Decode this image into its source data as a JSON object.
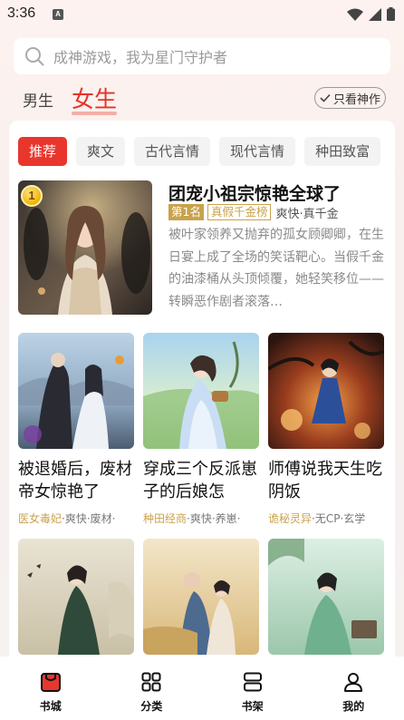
{
  "status_bar": {
    "time": "3:36",
    "notif_letter": "A"
  },
  "search": {
    "placeholder": "成神游戏，我为星门守护者"
  },
  "gender": {
    "male": "男生",
    "female": "女生",
    "only_divine": "只看神作"
  },
  "genre_tabs": [
    "推荐",
    "爽文",
    "古代言情",
    "现代言情",
    "种田致富"
  ],
  "featured": {
    "rank_number": "1",
    "title": "团宠小祖宗惊艳全球了",
    "rank_tag": "第1名",
    "list_tag": "真假千金榜",
    "genres": "爽快·真千金",
    "description": "被叶家领养又抛弃的孤女顾卿卿，在生日宴上成了全场的笑话靶心。当假千金的油漆桶从头顶倾覆，她轻笑移位——转瞬恶作剧者滚落…"
  },
  "books": [
    {
      "title": "被退婚后，废材帝女惊艳了",
      "category": "医女毒妃",
      "tags": "·爽快·废材·"
    },
    {
      "title": "穿成三个反派崽子的后娘怎",
      "category": "种田经商",
      "tags": "·爽快·养崽·"
    },
    {
      "title": "师傅说我天生吃阴饭",
      "category": "诡秘灵异",
      "tags": "·无CP·玄学"
    },
    {
      "title": "",
      "category": "",
      "tags": ""
    },
    {
      "title": "",
      "category": "",
      "tags": ""
    },
    {
      "title": "",
      "category": "",
      "tags": ""
    }
  ],
  "bottom_nav": [
    {
      "label": "书城",
      "icon": "bookstore-icon"
    },
    {
      "label": "分类",
      "icon": "category-icon"
    },
    {
      "label": "书架",
      "icon": "bookshelf-icon"
    },
    {
      "label": "我的",
      "icon": "profile-icon"
    }
  ],
  "colors": {
    "accent": "#e8362d",
    "gold": "#c9a24c"
  }
}
